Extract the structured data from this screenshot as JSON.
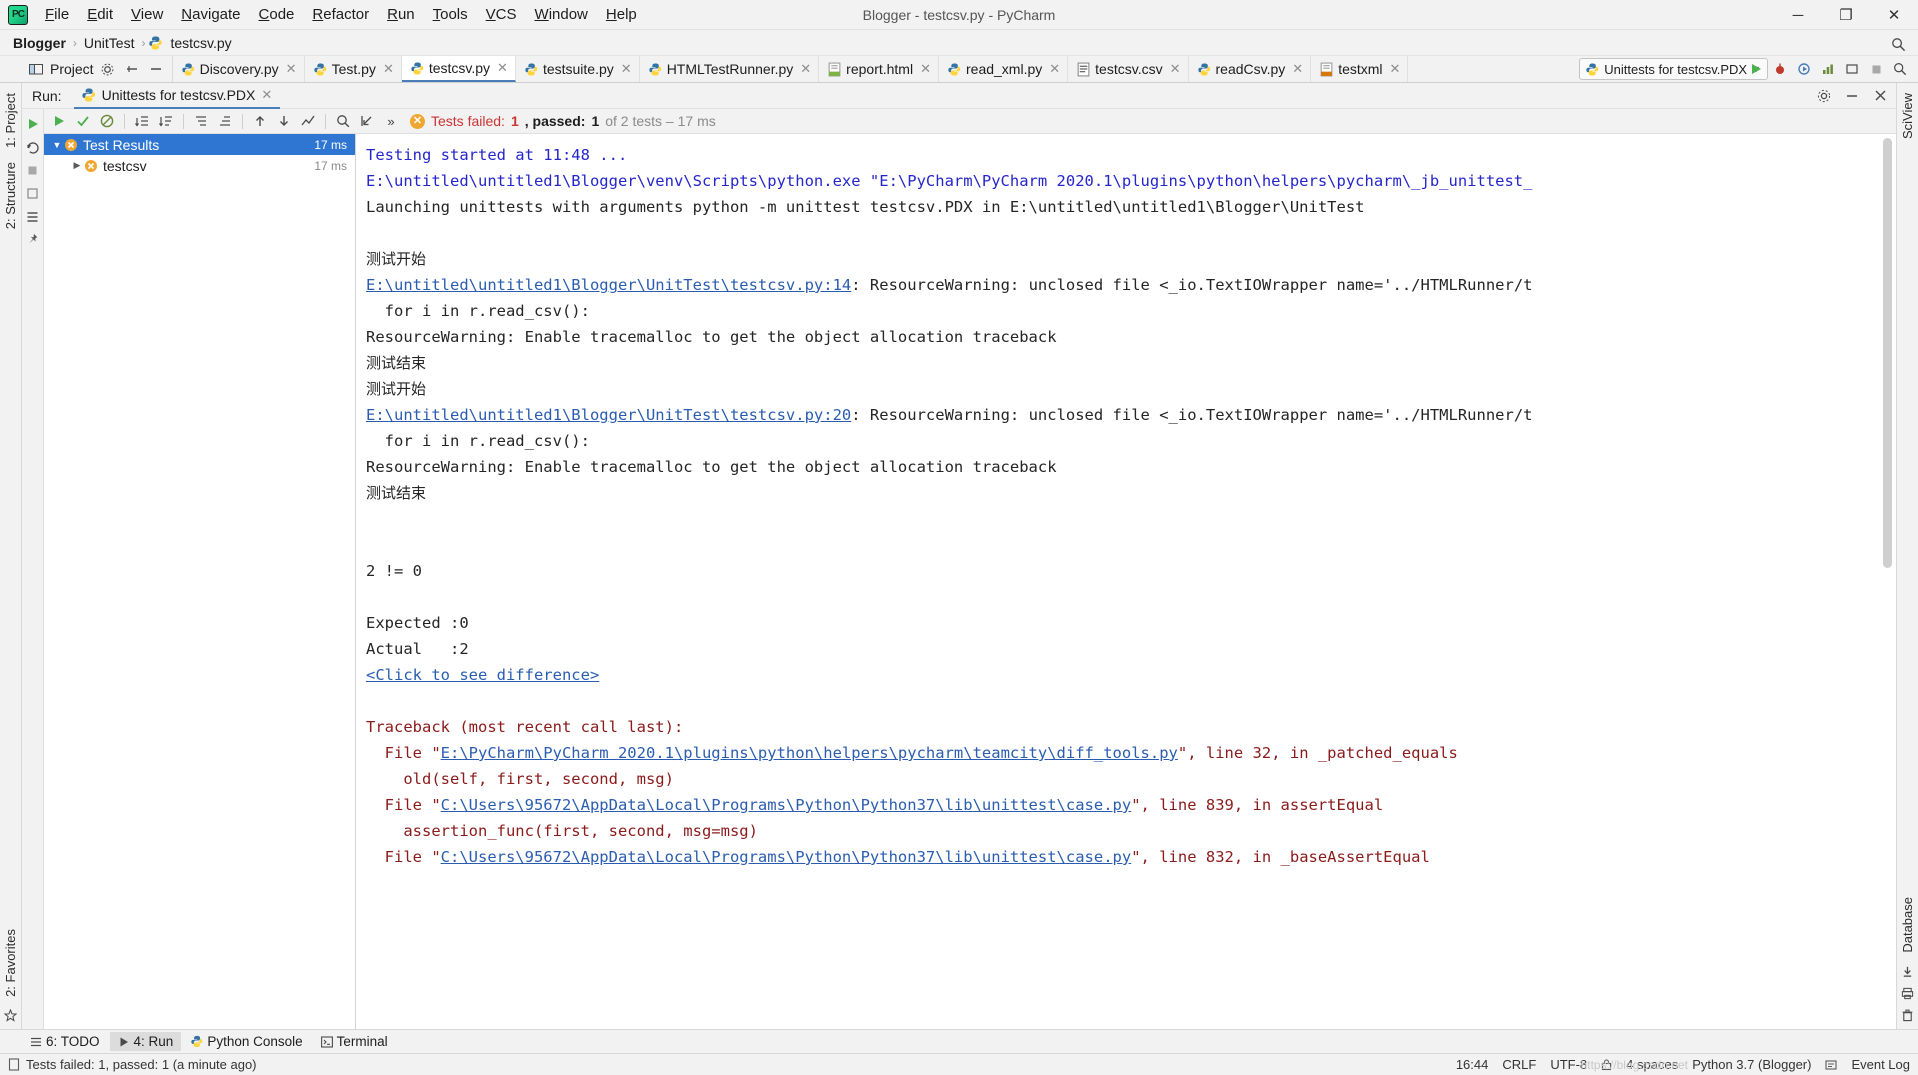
{
  "window": {
    "title": "Blogger - testcsv.py - PyCharm",
    "logo_text": "PC",
    "minimize": "─",
    "maximize": "❐",
    "close": "✕"
  },
  "menu": {
    "items": [
      {
        "label": "File",
        "name": "menu-file"
      },
      {
        "label": "Edit",
        "name": "menu-edit"
      },
      {
        "label": "View",
        "name": "menu-view"
      },
      {
        "label": "Navigate",
        "name": "menu-navigate"
      },
      {
        "label": "Code",
        "name": "menu-code"
      },
      {
        "label": "Refactor",
        "name": "menu-refactor"
      },
      {
        "label": "Run",
        "name": "menu-run"
      },
      {
        "label": "Tools",
        "name": "menu-tools"
      },
      {
        "label": "VCS",
        "name": "menu-vcs"
      },
      {
        "label": "Window",
        "name": "menu-window"
      },
      {
        "label": "Help",
        "name": "menu-help"
      }
    ]
  },
  "breadcrumbs": {
    "items": [
      "Blogger",
      "UnitTest",
      "testcsv.py"
    ],
    "separator": "›"
  },
  "toolbar": {
    "project_label": "Project",
    "run_config": "Unittests for testcsv.PDX",
    "dropdown_arrow": "▾"
  },
  "editor_tabs": [
    {
      "label": "Discovery.py",
      "icon": "python-file-icon",
      "active": false
    },
    {
      "label": "Test.py",
      "icon": "python-file-icon",
      "active": false
    },
    {
      "label": "testcsv.py",
      "icon": "python-file-icon",
      "active": true
    },
    {
      "label": "testsuite.py",
      "icon": "python-file-icon",
      "active": false
    },
    {
      "label": "HTMLTestRunner.py",
      "icon": "python-file-icon",
      "active": false
    },
    {
      "label": "report.html",
      "icon": "html-file-icon",
      "active": false
    },
    {
      "label": "read_xml.py",
      "icon": "python-file-icon",
      "active": false
    },
    {
      "label": "testcsv.csv",
      "icon": "csv-file-icon",
      "active": false
    },
    {
      "label": "readCsv.py",
      "icon": "python-file-icon",
      "active": false
    },
    {
      "label": "testxml",
      "icon": "xml-file-icon",
      "active": false
    }
  ],
  "run_window": {
    "run_label": "Run:",
    "tab_label": "Unittests for testcsv.PDX",
    "close_glyph": "✕",
    "status": {
      "badge": "✕",
      "failed_prefix": "Tests failed: ",
      "failed_count": "1",
      "passed_prefix": ", passed: ",
      "passed_count": "1",
      "of_text": " of 2 tests – 17 ms"
    },
    "overflow": "»"
  },
  "test_tree": {
    "rows": [
      {
        "label": "Test Results",
        "time": "17 ms",
        "arrow": "▼",
        "selected": true,
        "state": "failed"
      },
      {
        "label": "testcsv",
        "time": "17 ms",
        "arrow": "▶",
        "selected": false,
        "state": "failed"
      }
    ]
  },
  "console": {
    "lines": [
      {
        "segments": [
          {
            "t": "Testing started at 11:48 ...",
            "c": "c-blue"
          }
        ]
      },
      {
        "segments": [
          {
            "t": "E:\\untitled\\untitled1\\Blogger\\venv\\Scripts\\python.exe \"E:\\PyCharm\\PyCharm 2020.1\\plugins\\python\\helpers\\pycharm\\_jb_unittest_",
            "c": "c-blue"
          }
        ]
      },
      {
        "segments": [
          {
            "t": "Launching unittests with arguments python -m unittest testcsv.PDX in E:\\untitled\\untitled1\\Blogger\\UnitTest",
            "c": "c-dark"
          }
        ]
      },
      {
        "segments": [
          {
            "t": "",
            "c": "c-dark"
          }
        ]
      },
      {
        "segments": [
          {
            "t": "测试开始",
            "c": "c-cjk"
          }
        ]
      },
      {
        "segments": [
          {
            "t": "E:\\untitled\\untitled1\\Blogger\\UnitTest\\testcsv.py:14",
            "c": "c-link"
          },
          {
            "t": ": ResourceWarning: unclosed file <_io.TextIOWrapper name='../HTMLRunner/t",
            "c": "c-dark"
          }
        ]
      },
      {
        "segments": [
          {
            "t": "  for i in r.read_csv():",
            "c": "c-dark"
          }
        ]
      },
      {
        "segments": [
          {
            "t": "ResourceWarning: Enable tracemalloc to get the object allocation traceback",
            "c": "c-dark"
          }
        ]
      },
      {
        "segments": [
          {
            "t": "测试结束",
            "c": "c-cjk"
          }
        ]
      },
      {
        "segments": [
          {
            "t": "测试开始",
            "c": "c-cjk"
          }
        ]
      },
      {
        "segments": [
          {
            "t": "E:\\untitled\\untitled1\\Blogger\\UnitTest\\testcsv.py:20",
            "c": "c-link"
          },
          {
            "t": ": ResourceWarning: unclosed file <_io.TextIOWrapper name='../HTMLRunner/t",
            "c": "c-dark"
          }
        ]
      },
      {
        "segments": [
          {
            "t": "  for i in r.read_csv():",
            "c": "c-dark"
          }
        ]
      },
      {
        "segments": [
          {
            "t": "ResourceWarning: Enable tracemalloc to get the object allocation traceback",
            "c": "c-dark"
          }
        ]
      },
      {
        "segments": [
          {
            "t": "测试结束",
            "c": "c-cjk"
          }
        ]
      },
      {
        "segments": [
          {
            "t": "",
            "c": "c-dark"
          }
        ]
      },
      {
        "segments": [
          {
            "t": "",
            "c": "c-dark"
          }
        ]
      },
      {
        "segments": [
          {
            "t": "2 != 0",
            "c": "c-dark"
          }
        ]
      },
      {
        "segments": [
          {
            "t": "",
            "c": "c-dark"
          }
        ]
      },
      {
        "segments": [
          {
            "t": "Expected :0",
            "c": "c-dark"
          }
        ]
      },
      {
        "segments": [
          {
            "t": "Actual   :2",
            "c": "c-dark"
          }
        ]
      },
      {
        "segments": [
          {
            "t": "<Click to see difference>",
            "c": "c-link"
          }
        ]
      },
      {
        "segments": [
          {
            "t": "",
            "c": "c-dark"
          }
        ]
      },
      {
        "segments": [
          {
            "t": "Traceback (most recent call last):",
            "c": "c-red"
          }
        ]
      },
      {
        "segments": [
          {
            "t": "  File \"",
            "c": "c-red"
          },
          {
            "t": "E:\\PyCharm\\PyCharm 2020.1\\plugins\\python\\helpers\\pycharm\\teamcity\\diff_tools.py",
            "c": "c-link"
          },
          {
            "t": "\", line 32, in _patched_equals",
            "c": "c-red"
          }
        ]
      },
      {
        "segments": [
          {
            "t": "    old(self, first, second, msg)",
            "c": "c-red"
          }
        ]
      },
      {
        "segments": [
          {
            "t": "  File \"",
            "c": "c-red"
          },
          {
            "t": "C:\\Users\\95672\\AppData\\Local\\Programs\\Python\\Python37\\lib\\unittest\\case.py",
            "c": "c-link"
          },
          {
            "t": "\", line 839, in assertEqual",
            "c": "c-red"
          }
        ]
      },
      {
        "segments": [
          {
            "t": "    assertion_func(first, second, msg=msg)",
            "c": "c-red"
          }
        ]
      },
      {
        "segments": [
          {
            "t": "  File \"",
            "c": "c-red"
          },
          {
            "t": "C:\\Users\\95672\\AppData\\Local\\Programs\\Python\\Python37\\lib\\unittest\\case.py",
            "c": "c-link"
          },
          {
            "t": "\", line 832, in _baseAssertEqual",
            "c": "c-red"
          }
        ]
      }
    ]
  },
  "left_stripe": {
    "top": [
      "1: Project",
      "2: Structure"
    ],
    "bottom": [
      "2: Favorites"
    ]
  },
  "right_stripe": {
    "top": [
      "SciView"
    ],
    "bottom": [
      "Database"
    ]
  },
  "bottom_tools": [
    {
      "label": "6: TODO",
      "icon": "todo-icon",
      "active": false
    },
    {
      "label": "4: Run",
      "icon": "run-icon",
      "active": true
    },
    {
      "label": "Python Console",
      "icon": "python-icon",
      "active": false
    },
    {
      "label": "Terminal",
      "icon": "terminal-icon",
      "active": false
    }
  ],
  "statusbar": {
    "message": "Tests failed: 1, passed: 1 (a minute ago)",
    "time": "16:44",
    "line_sep": "CRLF",
    "encoding": "UTF-8",
    "indent": "4 spaces",
    "interpreter": "Python 3.7 (Blogger)",
    "event_log": "Event Log",
    "watermark": "https://blog.csdn.net"
  },
  "colors": {
    "accent_blue": "#2f76d2",
    "link_blue": "#2a5db0",
    "console_blue": "#2525cc",
    "error_red": "#8b1a1a",
    "fail_orange": "#f0a732",
    "fail_text": "#cc3333"
  }
}
